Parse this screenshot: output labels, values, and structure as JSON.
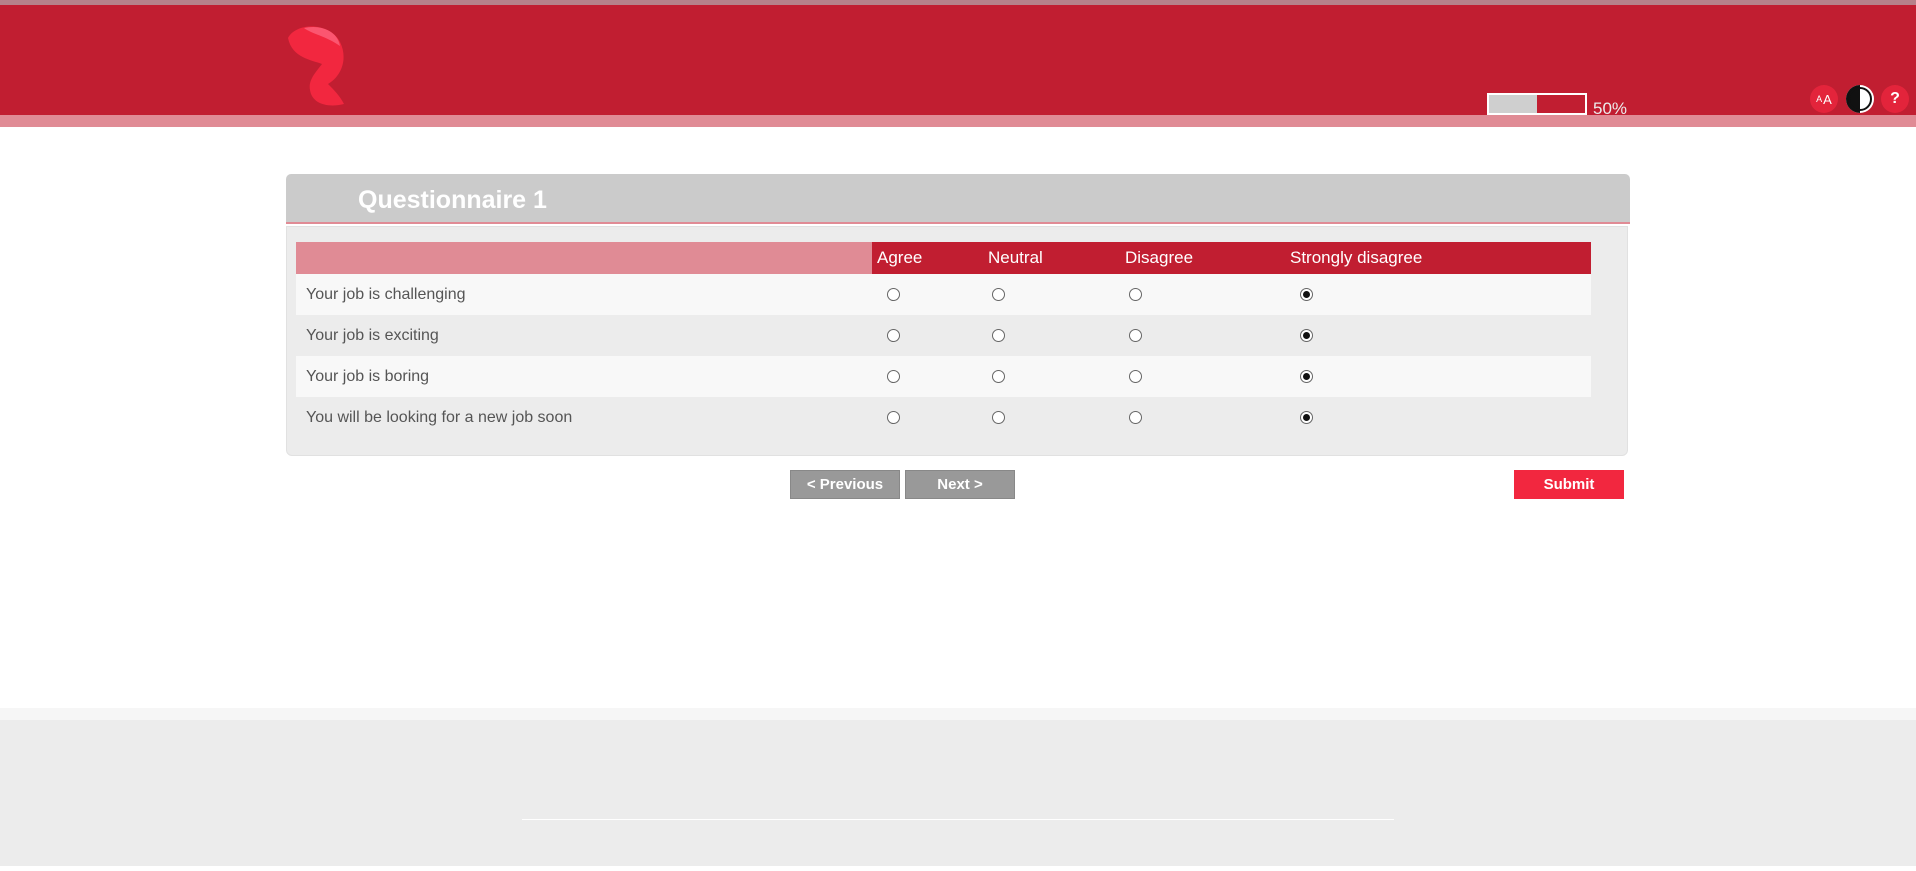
{
  "header": {
    "progress": {
      "percent": 50,
      "label": "50%"
    },
    "tools": {
      "font_size_label_small": "A",
      "font_size_label_large": "A",
      "help_label": "?"
    }
  },
  "questionnaire": {
    "title": "Questionnaire 1",
    "columns": [
      "Agree",
      "Neutral",
      "Disagree",
      "Strongly disagree"
    ],
    "rows": [
      {
        "question": "Your job is challenging",
        "selected": 3
      },
      {
        "question": "Your job is exciting",
        "selected": 3
      },
      {
        "question": "Your job is boring",
        "selected": 3
      },
      {
        "question": "You will be looking for a new job soon",
        "selected": 3
      }
    ]
  },
  "buttons": {
    "previous": "< Previous",
    "next": "Next >",
    "submit": "Submit"
  },
  "colors": {
    "brand_red": "#c11e31",
    "accent_pink": "#e08b95",
    "submit_red": "#f2273f"
  }
}
